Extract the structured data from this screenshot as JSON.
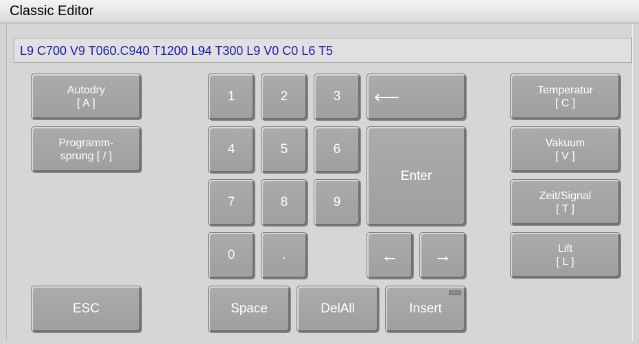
{
  "window": {
    "title": "Classic Editor"
  },
  "command_line": {
    "value": "L9 C700 V9 T060.C940 T1200 L94 T300 L9 V0 C0 L6 T5"
  },
  "left_buttons": {
    "autodry": {
      "line1": "Autodry",
      "line2": "[ A ]"
    },
    "jump": {
      "line1": "Programm-",
      "line2": "sprung [ / ]"
    },
    "esc": "ESC"
  },
  "keypad": {
    "k1": "1",
    "k2": "2",
    "k3": "3",
    "k4": "4",
    "k5": "5",
    "k6": "6",
    "k7": "7",
    "k8": "8",
    "k9": "9",
    "k0": "0",
    "dot": ".",
    "enter": "Enter",
    "space": "Space",
    "delall": "DelAll",
    "insert": "Insert",
    "backspace_icon": "long-left-arrow",
    "left_icon": "left-arrow",
    "right_icon": "right-arrow"
  },
  "right_buttons": {
    "temperature": {
      "line1": "Temperatur",
      "line2": "[ C ]"
    },
    "vacuum": {
      "line1": "Vakuum",
      "line2": "[ V ]"
    },
    "time_signal": {
      "line1": "Zeit/Signal",
      "line2": "[ T ]"
    },
    "lift": {
      "line1": "Lift",
      "line2": "[ L ]"
    }
  }
}
